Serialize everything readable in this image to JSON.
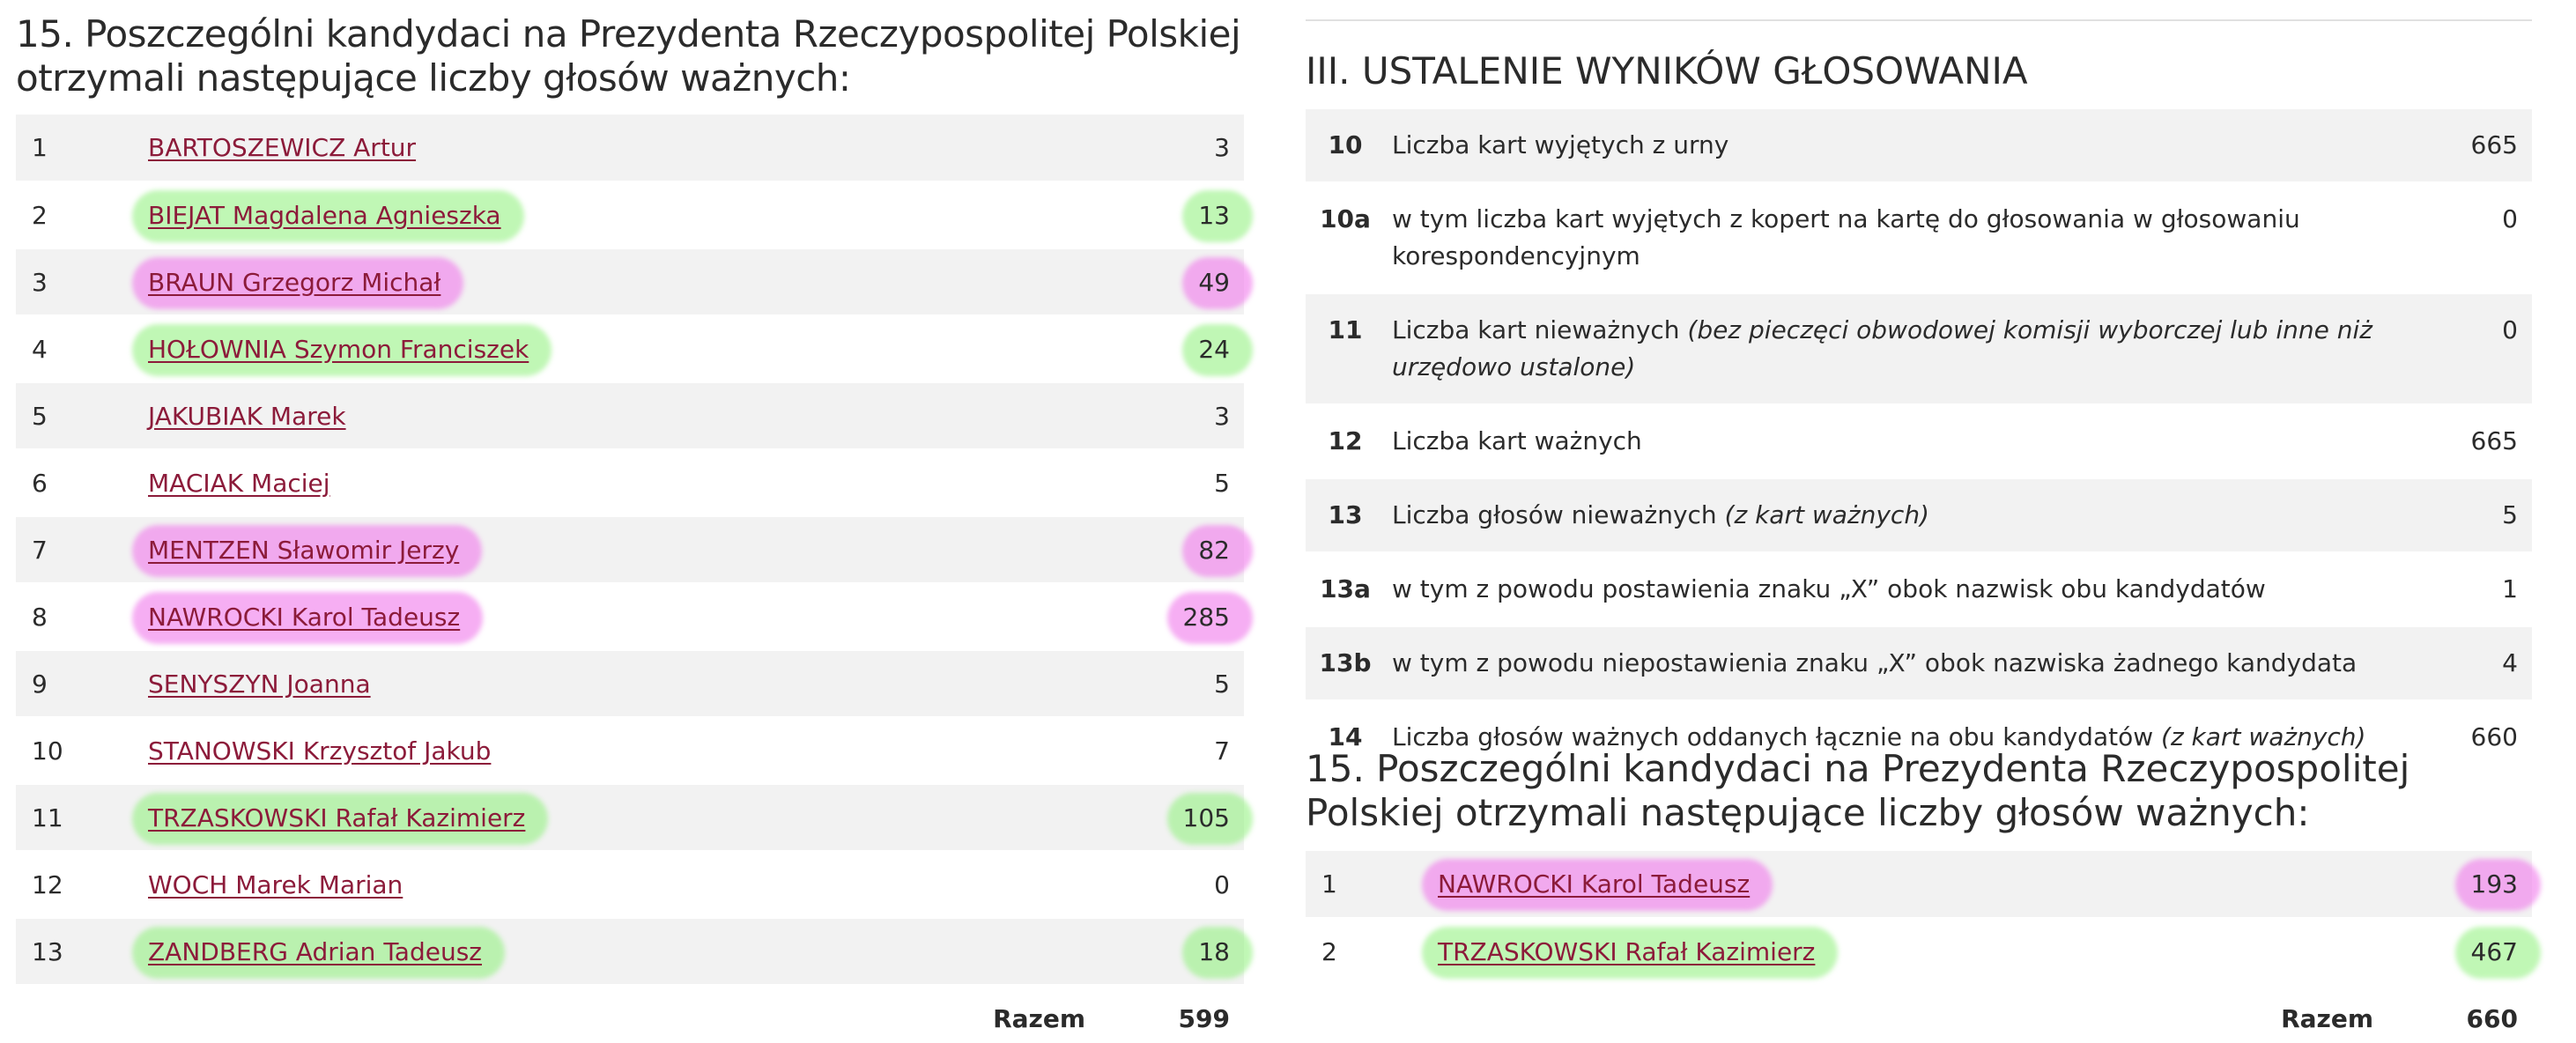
{
  "left": {
    "title": "15. Poszczególni kandydaci na Prezydenta Rzeczypospolitej Polskiej otrzymali następujące liczby głosów ważnych:",
    "candidates": [
      {
        "no": "1",
        "name": "BARTOSZEWICZ Artur",
        "votes": "3",
        "highlight": "none"
      },
      {
        "no": "2",
        "name": "BIEJAT Magdalena Agnieszka",
        "votes": "13",
        "highlight": "green"
      },
      {
        "no": "3",
        "name": "BRAUN Grzegorz Michał",
        "votes": "49",
        "highlight": "pink"
      },
      {
        "no": "4",
        "name": "HOŁOWNIA Szymon Franciszek",
        "votes": "24",
        "highlight": "green"
      },
      {
        "no": "5",
        "name": "JAKUBIAK Marek",
        "votes": "3",
        "highlight": "none"
      },
      {
        "no": "6",
        "name": "MACIAK Maciej",
        "votes": "5",
        "highlight": "none"
      },
      {
        "no": "7",
        "name": "MENTZEN Sławomir Jerzy",
        "votes": "82",
        "highlight": "pink"
      },
      {
        "no": "8",
        "name": "NAWROCKI Karol Tadeusz",
        "votes": "285",
        "highlight": "pink"
      },
      {
        "no": "9",
        "name": "SENYSZYN Joanna",
        "votes": "5",
        "highlight": "none"
      },
      {
        "no": "10",
        "name": "STANOWSKI Krzysztof Jakub",
        "votes": "7",
        "highlight": "none"
      },
      {
        "no": "11",
        "name": "TRZASKOWSKI Rafał Kazimierz",
        "votes": "105",
        "highlight": "green"
      },
      {
        "no": "12",
        "name": "WOCH Marek Marian",
        "votes": "0",
        "highlight": "none"
      },
      {
        "no": "13",
        "name": "ZANDBERG Adrian Tadeusz",
        "votes": "18",
        "highlight": "green"
      }
    ],
    "total_label": "Razem",
    "total_value": "599"
  },
  "right": {
    "section_title": "III. USTALENIE WYNIKÓW GŁOSOWANIA",
    "rows": [
      {
        "code": "10",
        "text": "Liczba kart wyjętych z urny",
        "note": "",
        "value": "665"
      },
      {
        "code": "10a",
        "text": "w tym liczba kart wyjętych z kopert na kartę do głosowania w głosowaniu korespondencyjnym",
        "note": "",
        "value": "0"
      },
      {
        "code": "11",
        "text": "Liczba kart nieważnych ",
        "note": "(bez pieczęci obwodowej komisji wyborczej lub inne niż urzędowo ustalone)",
        "value": "0"
      },
      {
        "code": "12",
        "text": "Liczba kart ważnych",
        "note": "",
        "value": "665"
      },
      {
        "code": "13",
        "text": "Liczba głosów nieważnych ",
        "note": "(z kart ważnych)",
        "value": "5"
      },
      {
        "code": "13a",
        "text": "w tym z powodu postawienia znaku „X” obok nazwisk obu kandydatów",
        "note": "",
        "value": "1"
      },
      {
        "code": "13b",
        "text": "w tym z powodu niepostawienia znaku „X” obok nazwiska żadnego kandydata",
        "note": "",
        "value": "4"
      },
      {
        "code": "14",
        "text": "Liczba głosów ważnych oddanych łącznie na obu kandydatów ",
        "note": "(z kart ważnych)",
        "value": "660"
      }
    ],
    "title15": "15. Poszczególni kandydaci na Prezydenta Rzeczypospolitej Polskiej otrzymali następujące liczby głosów ważnych:",
    "candidates": [
      {
        "no": "1",
        "name": "NAWROCKI Karol Tadeusz",
        "votes": "193",
        "highlight": "pink"
      },
      {
        "no": "2",
        "name": "TRZASKOWSKI Rafał Kazimierz",
        "votes": "467",
        "highlight": "green"
      }
    ],
    "total_label": "Razem",
    "total_value": "660"
  },
  "colors": {
    "link": "#8c1b3a",
    "stripe": "#f2f2f2",
    "highlight_green": "#8cf078",
    "highlight_pink": "#f078eb"
  }
}
